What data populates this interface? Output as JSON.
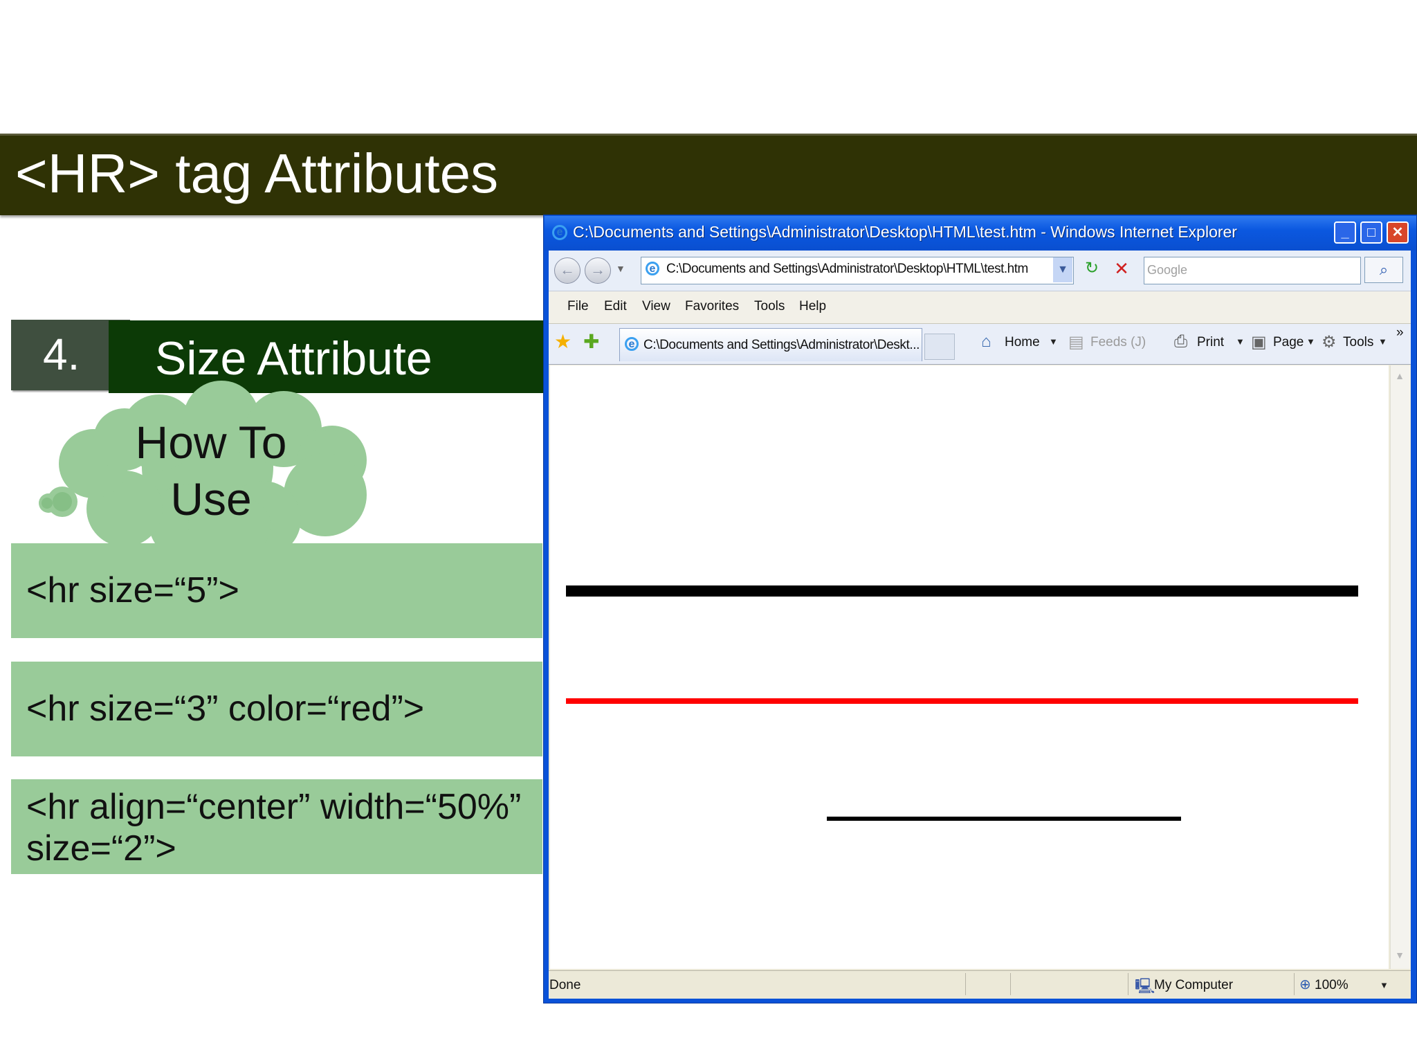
{
  "slide": {
    "title": "<HR> tag Attributes",
    "section_number": "4.",
    "section_heading": "Size Attribute",
    "cloud_line1": "How To",
    "cloud_line2": "Use",
    "code_examples": [
      "<hr size=“5”>",
      "<hr size=“3” color=“red”>",
      "<hr align=“center” width=“50%” size=“2”>"
    ]
  },
  "browser": {
    "window_title": "C:\\Documents and Settings\\Administrator\\Desktop\\HTML\\test.htm - Windows Internet Explorer",
    "address": "C:\\Documents and Settings\\Administrator\\Desktop\\HTML\\test.htm",
    "search_placeholder": "Google",
    "menu": [
      "File",
      "Edit",
      "View",
      "Favorites",
      "Tools",
      "Help"
    ],
    "tab_title": "C:\\Documents and Settings\\Administrator\\Deskt...",
    "commands": {
      "home": "Home",
      "feeds": "Feeds (J)",
      "print": "Print",
      "page": "Page",
      "tools": "Tools"
    },
    "status": "Done",
    "zone": "My Computer",
    "zoom": "100%",
    "rendered_rules": [
      {
        "size": 5,
        "color": "#000000",
        "width_percent": 100,
        "align": "full"
      },
      {
        "size": 3,
        "color": "#ff0000",
        "width_percent": 100,
        "align": "full"
      },
      {
        "size": 2,
        "color": "#000000",
        "width_percent": 50,
        "align": "center"
      }
    ]
  },
  "colors": {
    "title_bar": "#2f3205",
    "heading_green": "#0c3a06",
    "code_box_green": "#99cb99",
    "xp_blue": "#0a52d8"
  }
}
